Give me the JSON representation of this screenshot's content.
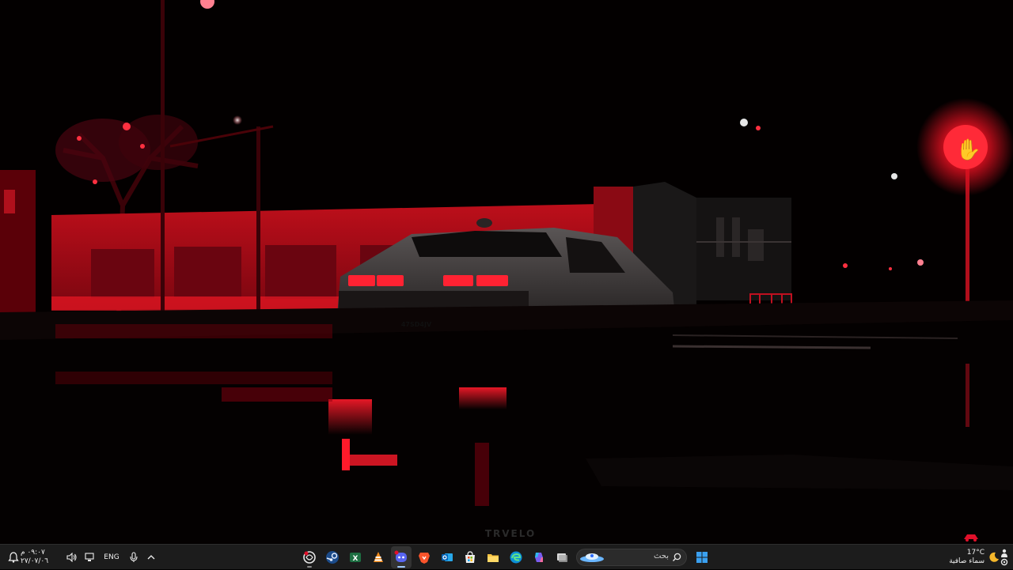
{
  "wallpaper": {
    "license_plate": "47SD4JV",
    "watermark": "TRVELO"
  },
  "taskbar": {
    "clock": {
      "time": "٠٩:٠٧ م",
      "date": "٢٧/٠٧/٠٦"
    },
    "language": "ENG",
    "search": {
      "placeholder": "بحث"
    },
    "weather": {
      "temperature": "17°C",
      "condition": "سماء صافية"
    },
    "apps": [
      {
        "name": "chatgpt-app-icon"
      },
      {
        "name": "steam-app-icon"
      },
      {
        "name": "excel-app-icon"
      },
      {
        "name": "vlc-app-icon"
      },
      {
        "name": "discord-app-icon"
      },
      {
        "name": "brave-app-icon"
      },
      {
        "name": "outlook-app-icon"
      },
      {
        "name": "microsoft-store-app-icon"
      },
      {
        "name": "file-explorer-app-icon"
      },
      {
        "name": "edge-app-icon"
      },
      {
        "name": "copilot-app-icon"
      },
      {
        "name": "task-view-app-icon"
      }
    ],
    "colors": {
      "taskbar_bg": "#1c1c1c",
      "accent_red": "#e0102a",
      "windows_blue": "#3aa0f0"
    }
  }
}
